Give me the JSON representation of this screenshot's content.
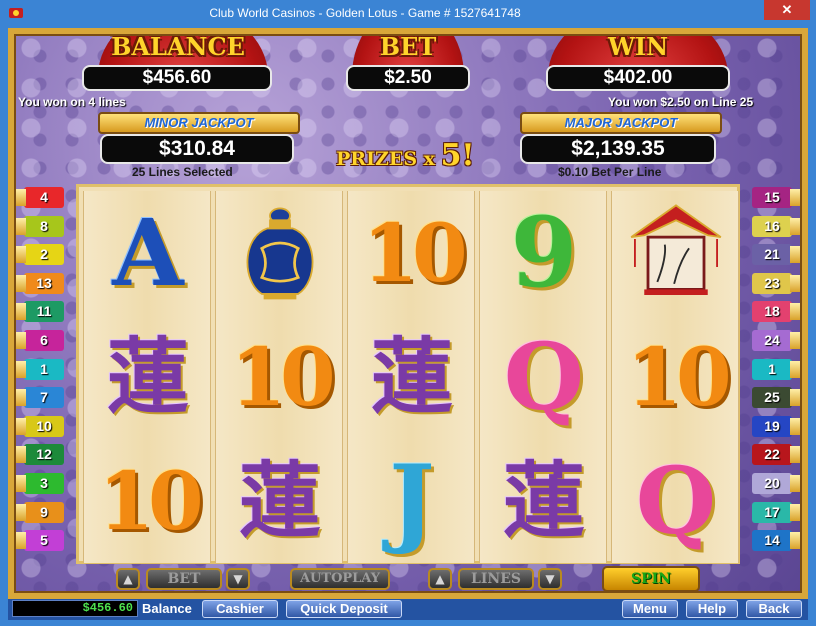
{
  "window": {
    "title": "Club World Casinos - Golden Lotus - Game # 1527641748",
    "close_label": "✕"
  },
  "header": {
    "balance_label": "BALANCE",
    "balance_value": "$456.60",
    "bet_label": "BET",
    "bet_value": "$2.50",
    "win_label": "WIN",
    "win_value": "$402.00",
    "left_message": "You won on 4 lines",
    "right_message": "You won $2.50 on Line 25"
  },
  "jackpots": {
    "minor_label": "MINOR JACKPOT",
    "minor_value": "$310.84",
    "minor_caption": "25 Lines Selected",
    "major_label": "MAJOR JACKPOT",
    "major_value": "$2,139.35",
    "major_caption": "$0.10 Bet Per Line"
  },
  "prizes": {
    "text": "PRIZES x",
    "multiplier": "5!"
  },
  "reels": [
    {
      "symbols": [
        {
          "glyph": "A",
          "kind": "A"
        },
        {
          "glyph": "蓮",
          "kind": "lotus"
        },
        {
          "glyph": "10",
          "kind": "10"
        }
      ]
    },
    {
      "symbols": [
        {
          "glyph": "",
          "kind": "vase"
        },
        {
          "glyph": "10",
          "kind": "10"
        },
        {
          "glyph": "蓮",
          "kind": "lotus"
        }
      ]
    },
    {
      "symbols": [
        {
          "glyph": "10",
          "kind": "10"
        },
        {
          "glyph": "蓮",
          "kind": "lotus"
        },
        {
          "glyph": "J",
          "kind": "J"
        }
      ]
    },
    {
      "symbols": [
        {
          "glyph": "9",
          "kind": "9"
        },
        {
          "glyph": "Q",
          "kind": "Q"
        },
        {
          "glyph": "蓮",
          "kind": "lotus"
        }
      ]
    },
    {
      "symbols": [
        {
          "glyph": "",
          "kind": "pagoda"
        },
        {
          "glyph": "10",
          "kind": "10"
        },
        {
          "glyph": "Q",
          "kind": "Q"
        }
      ]
    }
  ],
  "left_lines": [
    {
      "label": "4",
      "color": "#e8272a"
    },
    {
      "label": "8",
      "color": "#a7c61b"
    },
    {
      "label": "2",
      "color": "#e6d515"
    },
    {
      "label": "13",
      "color": "#f08a1b"
    },
    {
      "label": "11",
      "color": "#1d9a64"
    },
    {
      "label": "6",
      "color": "#c6249b"
    },
    {
      "label": "1",
      "color": "#1ab9c4"
    },
    {
      "label": "7",
      "color": "#2a86d6"
    },
    {
      "label": "10",
      "color": "#d8c817"
    },
    {
      "label": "12",
      "color": "#1d8a3a"
    },
    {
      "label": "3",
      "color": "#2dba2f"
    },
    {
      "label": "9",
      "color": "#e8901a"
    },
    {
      "label": "5",
      "color": "#c23fd6"
    }
  ],
  "right_lines": [
    {
      "label": "15",
      "color": "#a52483"
    },
    {
      "label": "16",
      "color": "#ddd14e"
    },
    {
      "label": "21",
      "color": "#6b61a6"
    },
    {
      "label": "23",
      "color": "#e0c64a"
    },
    {
      "label": "18",
      "color": "#e3416f"
    },
    {
      "label": "24",
      "color": "#a56bd2"
    },
    {
      "label": "1",
      "color": "#1ab9c4"
    },
    {
      "label": "25",
      "color": "#3b4a32"
    },
    {
      "label": "19",
      "color": "#2546c4"
    },
    {
      "label": "22",
      "color": "#b8161c"
    },
    {
      "label": "20",
      "color": "#b0a8d8"
    },
    {
      "label": "17",
      "color": "#2ab8a8"
    },
    {
      "label": "14",
      "color": "#1e74c8"
    }
  ],
  "controls": {
    "bet": "BET",
    "autoplay": "AUTOPLAY",
    "lines": "LINES",
    "spin": "SPIN",
    "up": "▲",
    "down": "▼"
  },
  "bottombar": {
    "balance_value": "$456.60",
    "balance_label": "Balance",
    "cashier": "Cashier",
    "quick_deposit": "Quick Deposit",
    "menu": "Menu",
    "help": "Help",
    "back": "Back"
  }
}
